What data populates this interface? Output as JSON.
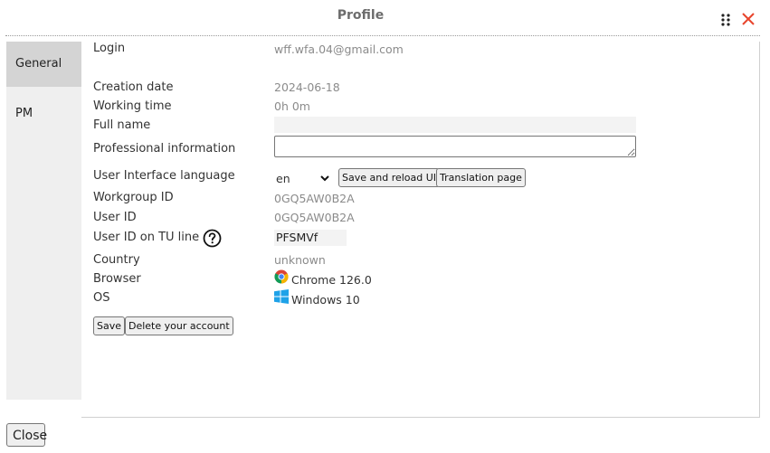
{
  "header": {
    "title": "Profile"
  },
  "sidebar": {
    "tabs": [
      {
        "label": "General",
        "active": true
      },
      {
        "label": "PM",
        "active": false
      }
    ]
  },
  "profile": {
    "login": {
      "label": "Login",
      "value": "wff.wfa.04@gmail.com"
    },
    "creation_date": {
      "label": "Creation date",
      "value": "2024-06-18"
    },
    "working_time": {
      "label": "Working time",
      "value": "0h 0m"
    },
    "full_name": {
      "label": "Full name",
      "value": ""
    },
    "professional_information": {
      "label": "Professional information",
      "value": ""
    },
    "ui_language": {
      "label": "User Interface language",
      "selected": "en",
      "save_reload_label": "Save and reload UI",
      "translation_page_label": "Translation page"
    },
    "workgroup_id": {
      "label": "Workgroup ID",
      "value": "0GQ5AW0B2A"
    },
    "user_id": {
      "label": "User ID",
      "value": "0GQ5AW0B2A"
    },
    "user_id_tu_line": {
      "label": "User ID on TU line",
      "value": "PFSMVf"
    },
    "country": {
      "label": "Country",
      "value": "unknown"
    },
    "browser": {
      "label": "Browser",
      "value": "Chrome 126.0",
      "icon": "chrome-icon"
    },
    "os": {
      "label": "OS",
      "value": "Windows 10",
      "icon": "windows-icon"
    }
  },
  "actions": {
    "save_label": "Save",
    "delete_label": "Delete your account"
  },
  "footer": {
    "close_label": "Close"
  },
  "colors": {
    "close_x": "#e8452c",
    "active_tab": "#d4d4d4",
    "sidebar_bg": "#efefef",
    "muted_text": "#8b8b8b"
  }
}
